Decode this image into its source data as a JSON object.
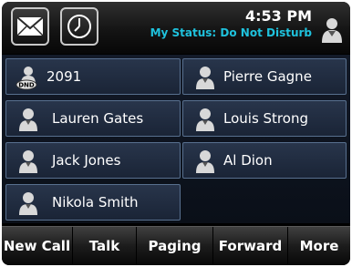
{
  "header": {
    "time": "4:53 PM",
    "status": "My Status: Do Not Disturb",
    "icons": [
      "mail-icon",
      "clock-icon",
      "user-avatar-icon"
    ]
  },
  "contacts": [
    {
      "name": "2091",
      "icon": "user-dnd-icon",
      "badge": "DND"
    },
    {
      "name": "Pierre Gagne",
      "icon": "user-icon"
    },
    {
      "name": "Lauren Gates",
      "icon": "user-icon"
    },
    {
      "name": "Louis Strong",
      "icon": "user-icon"
    },
    {
      "name": "Jack Jones",
      "icon": "user-icon"
    },
    {
      "name": "Al Dion",
      "icon": "user-icon"
    },
    {
      "name": "Nikola Smith",
      "icon": "user-icon"
    }
  ],
  "softkeys": [
    "New Call",
    "Talk",
    "Paging",
    "Forward",
    "More"
  ],
  "colors": {
    "status_text": "#1fc2dd",
    "cell_border": "#58708f",
    "cell_bg": "#28354b"
  }
}
